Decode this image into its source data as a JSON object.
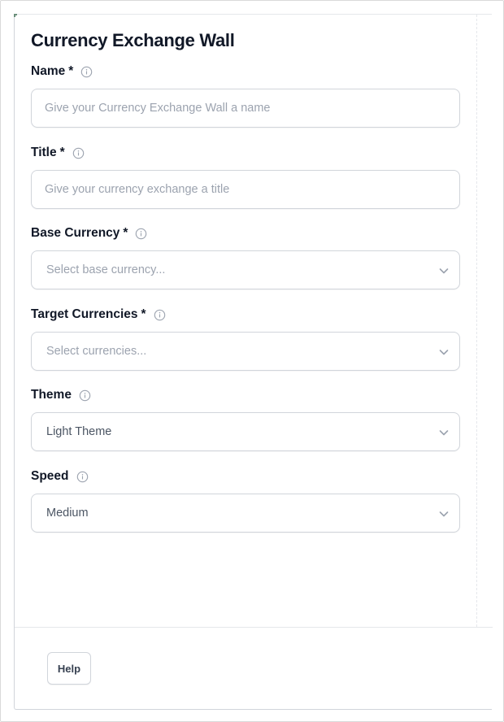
{
  "form": {
    "title": "Currency Exchange Wall",
    "required_marker": "*"
  },
  "fields": {
    "name": {
      "label": "Name",
      "required": true,
      "value": "",
      "placeholder": "Give your Currency Exchange Wall a name"
    },
    "title": {
      "label": "Title",
      "required": true,
      "value": "",
      "placeholder": "Give your currency exchange a title"
    },
    "base_currency": {
      "label": "Base Currency",
      "required": true,
      "selected": "Select base currency..."
    },
    "target_currencies": {
      "label": "Target Currencies",
      "required": true,
      "selected": "Select currencies..."
    },
    "theme": {
      "label": "Theme",
      "required": false,
      "selected": "Light Theme"
    },
    "speed": {
      "label": "Speed",
      "required": false,
      "selected": "Medium"
    }
  },
  "footer": {
    "help_label": "Help"
  },
  "icons": {
    "info": "info-circle-icon",
    "chevron": "chevron-down-icon"
  },
  "colors": {
    "text": "#111827",
    "placeholder": "#9ca3af",
    "border": "#d1d5db",
    "icon": "#9ca3af"
  }
}
